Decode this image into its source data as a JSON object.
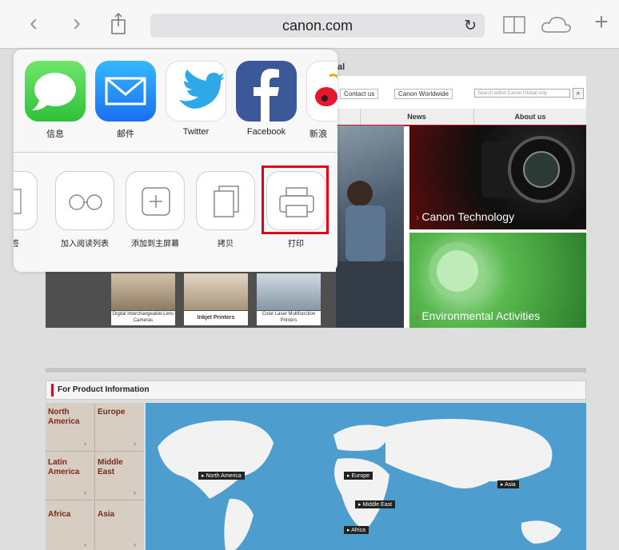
{
  "browser": {
    "address": "canon.com",
    "nav": {
      "back": "‹",
      "forward": "›",
      "share": "⇧",
      "bookmarks": "⎕",
      "cloud": "☁",
      "new_tab": "+"
    }
  },
  "site": {
    "title_fragment": "al",
    "top_links": [
      "Contact us",
      "Canon Worldwide"
    ],
    "search_placeholder": "Search within Canon Global only",
    "menu": [
      "News",
      "About us"
    ],
    "tiles": {
      "technology": "Canon Technology",
      "environment": "Environmental Activities"
    },
    "thumbs": [
      "Digital Interchangeable-Lens Cameras",
      "Inkjet Printers",
      "Color Laser Multifunction Printers"
    ],
    "product_header": "For Product Information",
    "regions": [
      {
        "name": "North America"
      },
      {
        "name": "Europe"
      },
      {
        "name": "Latin America"
      },
      {
        "name": "Middle East"
      },
      {
        "name": "Africa"
      },
      {
        "name": "Asia"
      }
    ],
    "map_labels": [
      "North America",
      "Europe",
      "Middle East",
      "Asia",
      "Africa"
    ]
  },
  "share_sheet": {
    "apps": [
      {
        "label": "信息",
        "icon": "messages-icon",
        "color": "#4cd964"
      },
      {
        "label": "邮件",
        "icon": "mail-icon",
        "color": "#1a8cf0"
      },
      {
        "label": "Twitter",
        "icon": "twitter-icon",
        "color": "#ffffff"
      },
      {
        "label": "Facebook",
        "icon": "facebook-icon",
        "color": "#3b5998"
      },
      {
        "label": "新浪",
        "icon": "weibo-icon",
        "color": "#ffffff"
      }
    ],
    "actions": [
      {
        "label": "签",
        "icon": "bookmark-icon"
      },
      {
        "label": "加入阅读列表",
        "icon": "reading-list-icon"
      },
      {
        "label": "添加到主屏幕",
        "icon": "add-to-home-icon"
      },
      {
        "label": "拷贝",
        "icon": "copy-icon"
      },
      {
        "label": "打印",
        "icon": "print-icon"
      }
    ],
    "highlight_color": "#e0001b"
  }
}
